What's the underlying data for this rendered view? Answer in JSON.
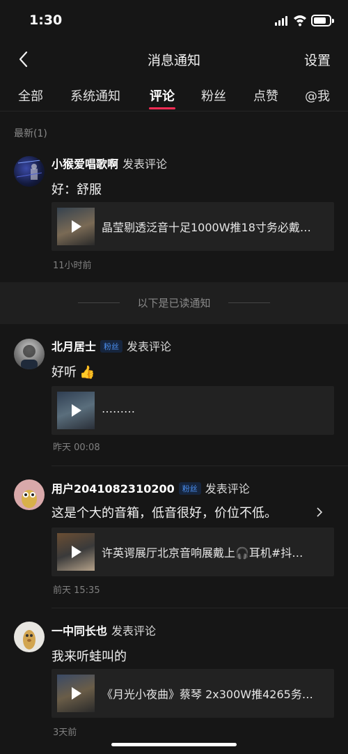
{
  "status_bar": {
    "time": "1:30"
  },
  "header": {
    "title": "消息通知",
    "settings_label": "设置"
  },
  "tabs": [
    {
      "label": "全部"
    },
    {
      "label": "系统通知"
    },
    {
      "label": "评论",
      "active": true
    },
    {
      "label": "粉丝"
    },
    {
      "label": "点赞"
    },
    {
      "label": "@我"
    }
  ],
  "recent_section": {
    "label": "最新(1)"
  },
  "read_divider": {
    "label": "以下是已读通知"
  },
  "notifications": [
    {
      "username": "小猴爱唱歌啊",
      "action": "发表评论",
      "badge": "",
      "comment": "好：舒服",
      "video_title": "晶莹剔透泛音十足1000W推18寸务必戴…",
      "time": "11小时前"
    },
    {
      "username": "北月居士",
      "badge": "粉丝",
      "action": "发表评论",
      "comment": "好听",
      "emoji": "👍",
      "video_title": "………",
      "time": "昨天 00:08"
    },
    {
      "username": "用户2041082310200",
      "badge": "粉丝",
      "action": "发表评论",
      "comment": "这是个大的音箱，低音很好，价位不低。",
      "video_title": "许英谔展厅北京音响展戴上🎧耳机#抖…",
      "time": "前天 15:35"
    },
    {
      "username": "一中同长也",
      "badge": "",
      "action": "发表评论",
      "comment": "我来听蛙叫的",
      "video_title": "《月光小夜曲》蔡琴 2x300W推4265务…",
      "time": "3天前"
    }
  ],
  "colors": {
    "background": "#161616",
    "accent": "#fe2c55",
    "badge": "#4b8ff0"
  }
}
